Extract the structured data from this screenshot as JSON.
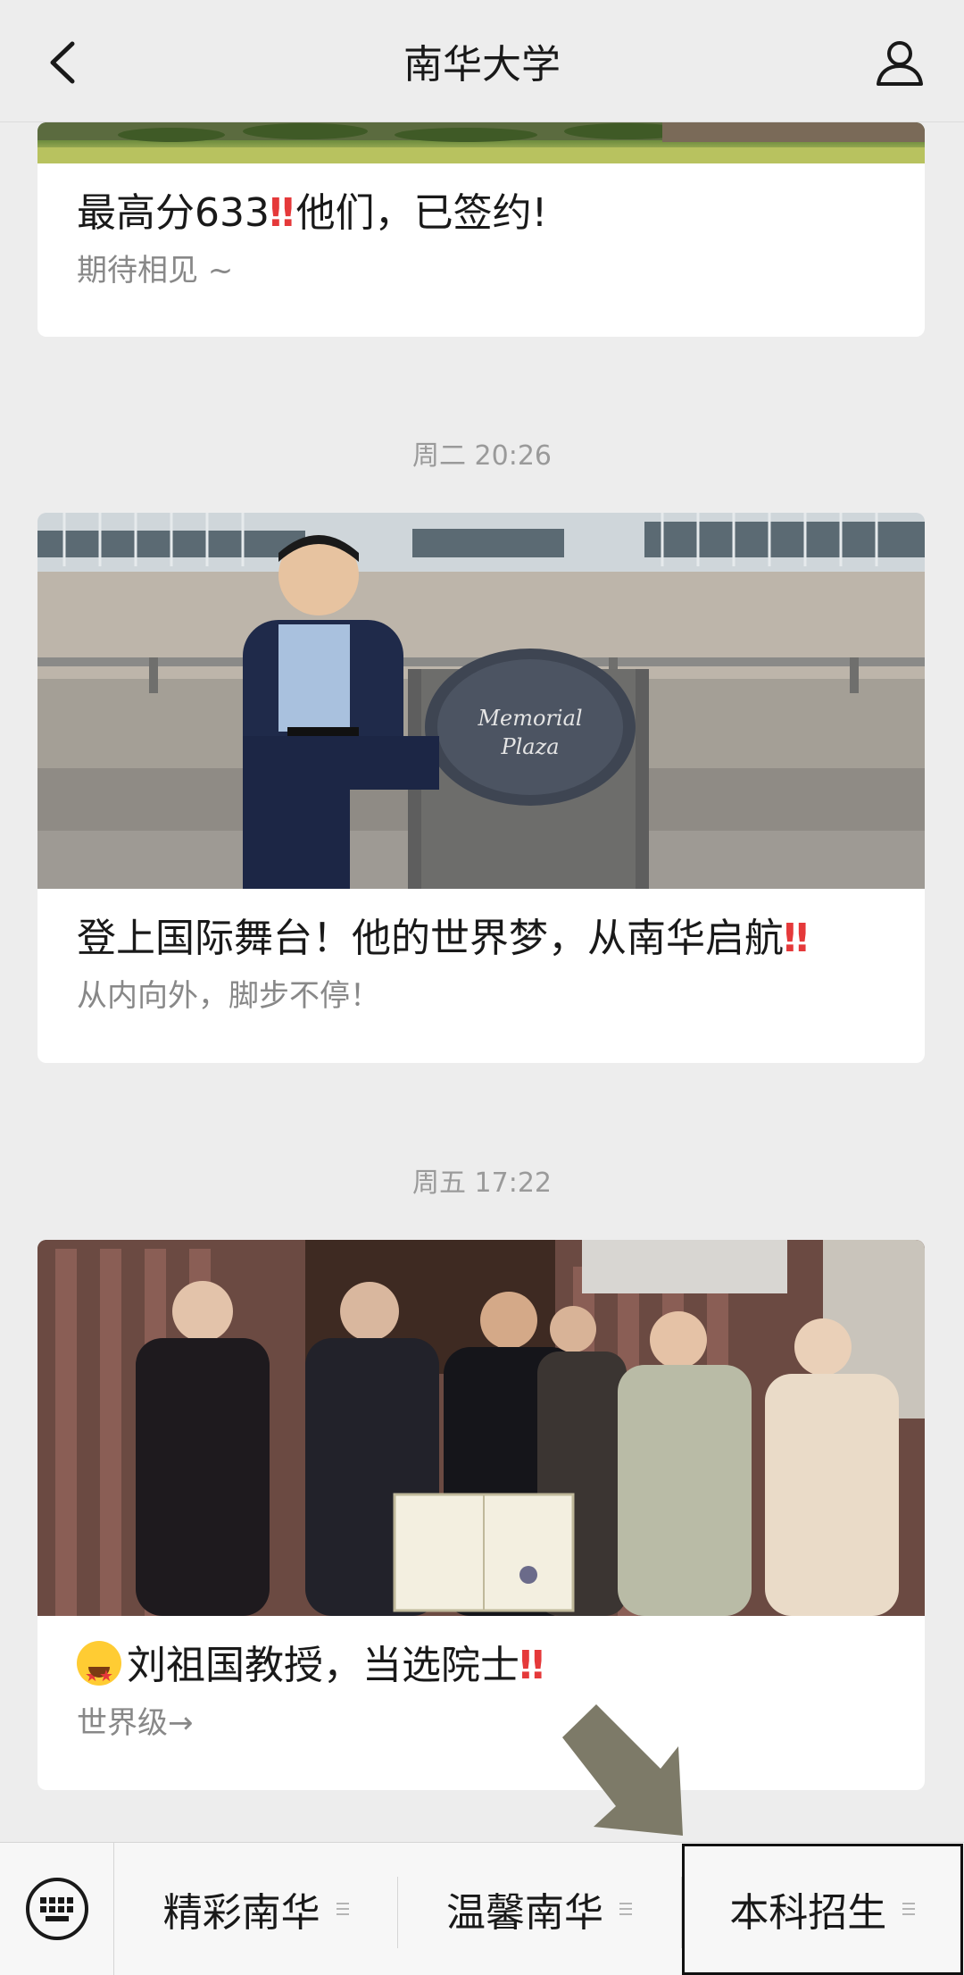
{
  "header": {
    "title": "南华大学"
  },
  "feed": {
    "articles": [
      {
        "title_before": "最高分633",
        "title_after": "他们，已签约!",
        "excl": "‼",
        "subtitle": "期待相见 ~"
      },
      {
        "timestamp": "周二 20:26",
        "plaque_text": "Memorial Plaza",
        "title_before": "登上国际舞台！他的世界梦，从南华启航",
        "excl": "‼",
        "subtitle": "从内向外，脚步不停！"
      },
      {
        "timestamp": "周五 17:22",
        "title_before": "刘祖国教授，当选院士",
        "excl": "‼",
        "subtitle": "世界级→"
      }
    ]
  },
  "bottom_menu": {
    "items": [
      {
        "label": "精彩南华"
      },
      {
        "label": "温馨南华"
      },
      {
        "label": "本科招生"
      }
    ]
  },
  "icons": {
    "back": "chevron-left-icon",
    "profile": "person-icon",
    "keyboard": "keyboard-icon",
    "menu": "menu-lines-icon",
    "arrow": "pointer-arrow-icon"
  },
  "colors": {
    "background": "#ededed",
    "card": "#ffffff",
    "accent_red": "#e5393a",
    "arrow": "#7d7a68"
  }
}
